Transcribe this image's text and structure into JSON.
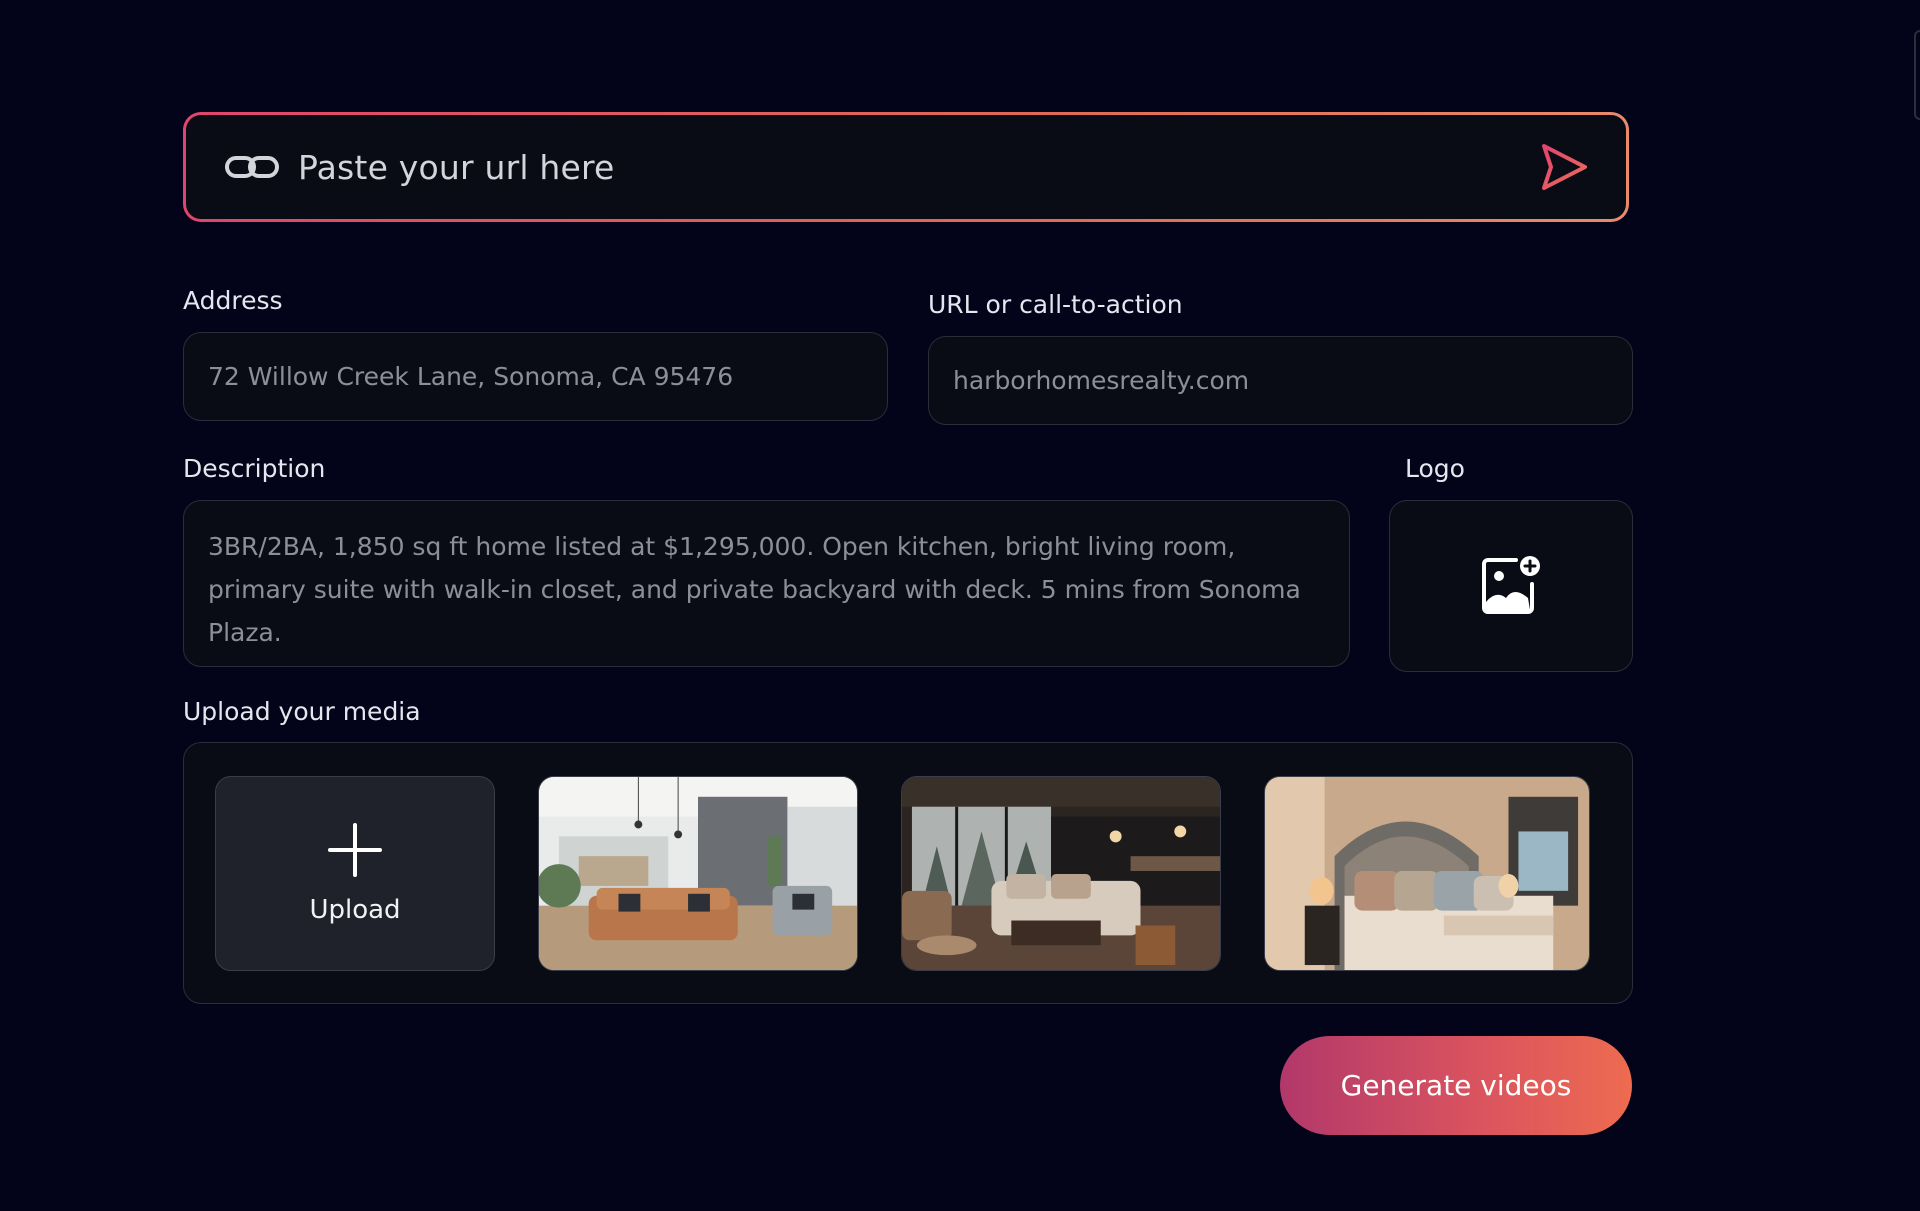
{
  "url_bar": {
    "placeholder": "Paste your url here",
    "link_icon": "link-icon",
    "send_icon": "send-icon"
  },
  "address": {
    "label": "Address",
    "value": "72 Willow Creek Lane, Sonoma, CA 95476"
  },
  "cta": {
    "label": "URL or call-to-action",
    "value": "harborhomesrealty.com"
  },
  "description": {
    "label": "Description",
    "value": "3BR/2BA, 1,850 sq ft home listed at $1,295,000. Open kitchen, bright living room, primary suite with walk-in closet, and private backyard with deck. 5 mins from Sonoma Plaza."
  },
  "logo": {
    "label": "Logo",
    "icon": "add-image-icon"
  },
  "media": {
    "label": "Upload your media",
    "upload_label": "Upload",
    "upload_icon": "plus-icon",
    "thumbnails": [
      {
        "name": "living-room-photo"
      },
      {
        "name": "open-plan-living-photo"
      },
      {
        "name": "bedroom-photo"
      }
    ]
  },
  "actions": {
    "generate_label": "Generate videos"
  },
  "colors": {
    "background": "#03041a",
    "accent_start": "#e0456e",
    "accent_end": "#ee6b50",
    "field_bg": "#0a0c15"
  }
}
